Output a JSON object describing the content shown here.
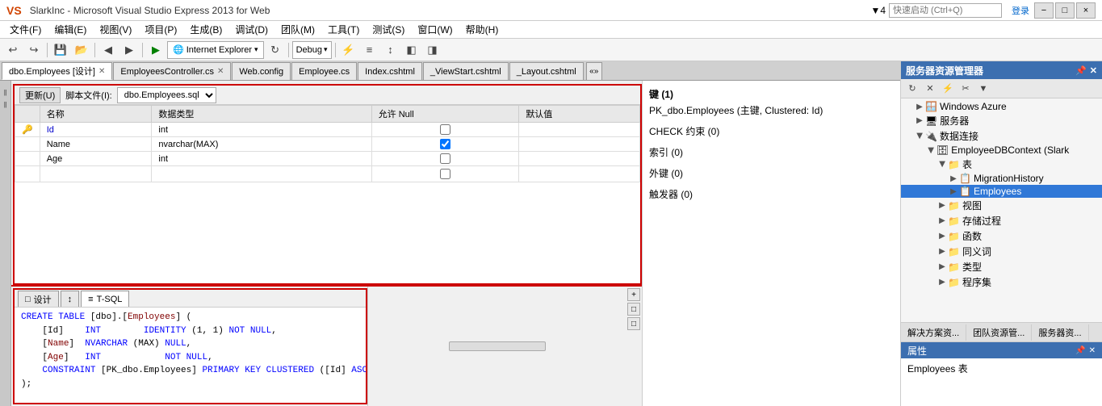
{
  "title_bar": {
    "logo": "VS",
    "text": "SlarkInc - Microsoft Visual Studio Express 2013 for Web",
    "minimize": "−",
    "restore": "□",
    "close": "×",
    "quick_launch_placeholder": "快速启动 (Ctrl+Q)",
    "login": "登录",
    "wifi_icon": "▼4"
  },
  "menu": {
    "items": [
      "文件(F)",
      "编辑(E)",
      "视图(V)",
      "项目(P)",
      "生成(B)",
      "调试(D)",
      "团队(M)",
      "工具(T)",
      "测试(S)",
      "窗口(W)",
      "帮助(H)"
    ]
  },
  "toolbar": {
    "back": "◀",
    "forward": "▶",
    "ie_label": "Internet Explorer",
    "ie_arrow": "▾",
    "refresh": "↻",
    "sep": "",
    "debug_label": "Debug",
    "debug_arrow": "▾"
  },
  "tabs": [
    {
      "label": "dbo.Employees [设计]",
      "active": true,
      "closable": true
    },
    {
      "label": "EmployeesController.cs",
      "active": false,
      "closable": true
    },
    {
      "label": "Web.config",
      "active": false,
      "closable": false
    },
    {
      "label": "Employee.cs",
      "active": false,
      "closable": false
    },
    {
      "label": "Index.cshtml",
      "active": false,
      "closable": false
    },
    {
      "label": "_ViewStart.cshtml",
      "active": false,
      "closable": false
    },
    {
      "label": "_Layout.cshtml",
      "active": false,
      "closable": false
    }
  ],
  "tab_overflow": "«»",
  "update_toolbar": {
    "update_btn": "更新(U)",
    "script_label": "脚本文件(I):",
    "script_value": "dbo.Employees.sql"
  },
  "db_table": {
    "headers": [
      "名称",
      "数据类型",
      "允许 Null",
      "默认值"
    ],
    "rows": [
      {
        "pk": true,
        "name": "Id",
        "type": "int",
        "null": false,
        "default": ""
      },
      {
        "pk": false,
        "name": "Name",
        "type": "nvarchar(MAX)",
        "null": true,
        "default": ""
      },
      {
        "pk": false,
        "name": "Age",
        "type": "int",
        "null": false,
        "default": ""
      },
      {
        "pk": false,
        "name": "",
        "type": "",
        "null": false,
        "default": ""
      }
    ]
  },
  "right_panel": {
    "keys_section": "键 (1)",
    "pk_item": "PK_dbo.Employees  (主键, Clustered: Id)",
    "check_section": "CHECK 约束 (0)",
    "index_section": "索引 (0)",
    "foreign_section": "外键 (0)",
    "trigger_section": "触发器 (0)"
  },
  "bottom_tabs": [
    {
      "label": "设计",
      "icon": "□",
      "active": false
    },
    {
      "label": "↕",
      "icon": "",
      "active": false
    },
    {
      "label": "T-SQL",
      "icon": "≡",
      "active": true
    }
  ],
  "sql_content": {
    "line1": "CREATE TABLE [dbo].[Employees] (",
    "line2": "    [Id]    INT        IDENTITY (1, 1) NOT NULL,",
    "line3": "    [Name]  NVARCHAR (MAX) NULL,",
    "line4": "    [Age]   INT            NOT NULL,",
    "line5": "    CONSTRAINT [PK_dbo.Employees] PRIMARY KEY CLUSTERED ([Id] ASC)",
    "line6": ");"
  },
  "sidebar": {
    "title": "服务器资源管理器",
    "toolbar_icons": [
      "↻",
      "✕",
      "≡≡",
      "↑",
      "↓"
    ],
    "tree": [
      {
        "level": 0,
        "expanded": true,
        "icon": "🪟",
        "label": "Windows Azure"
      },
      {
        "level": 0,
        "expanded": false,
        "icon": "🖥",
        "label": "服务器"
      },
      {
        "level": 0,
        "expanded": true,
        "icon": "🔌",
        "label": "数据连接"
      },
      {
        "level": 1,
        "expanded": true,
        "icon": "🗄",
        "label": "EmployeeDBContext (Slark"
      },
      {
        "level": 2,
        "expanded": true,
        "icon": "📁",
        "label": "表"
      },
      {
        "level": 3,
        "expanded": false,
        "icon": "📋",
        "label": "MigrationHistory"
      },
      {
        "level": 3,
        "expanded": false,
        "icon": "📋",
        "label": "Employees",
        "selected": true
      },
      {
        "level": 2,
        "expanded": false,
        "icon": "📁",
        "label": "视图"
      },
      {
        "level": 2,
        "expanded": false,
        "icon": "📁",
        "label": "存储过程"
      },
      {
        "level": 2,
        "expanded": false,
        "icon": "📁",
        "label": "函数"
      },
      {
        "level": 2,
        "expanded": false,
        "icon": "📁",
        "label": "同义词"
      },
      {
        "level": 2,
        "expanded": false,
        "icon": "📁",
        "label": "类型"
      },
      {
        "level": 2,
        "expanded": false,
        "icon": "📁",
        "label": "程序集"
      }
    ],
    "bottom_tabs": [
      "解决方案资...",
      "团队资源管...",
      "服务器资..."
    ],
    "props_title": "属性",
    "props_content": "Employees 表"
  },
  "sidebar_pin": "📌",
  "bottom_right_icons": [
    "+",
    "□",
    "□"
  ]
}
